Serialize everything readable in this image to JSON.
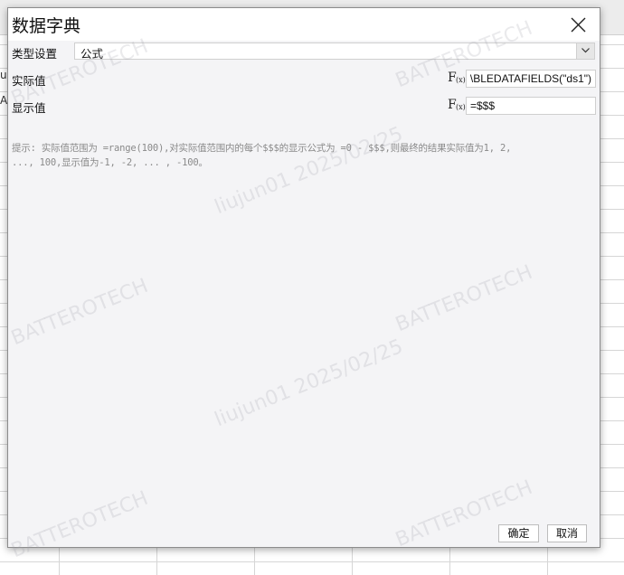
{
  "dialog": {
    "title": "数据字典",
    "type_label": "类型设置",
    "type_value": "公式",
    "actual_label": "实际值",
    "actual_formula": "\\BLEDATAFIELDS(\"ds1\")",
    "display_label": "显示值",
    "display_formula": "=$$$",
    "hint_line1": "提示: 实际值范围为 =range(100),对实际值范围内的每个$$$的显示公式为 =0 - $$$,则最终的结果实际值为1, 2,",
    "hint_line2": "..., 100,显示值为-1, -2, ... , -100。",
    "ok_label": "确定",
    "cancel_label": "取消"
  },
  "fx_icon": {
    "big": "F",
    "small": "(x)"
  },
  "watermark": {
    "company": "BATTEROTECH",
    "user_date": "liujun01 2025/02/25"
  },
  "sheet": {
    "frag_a": "un",
    "frag_b": "A"
  },
  "icons": {
    "close": "close-icon",
    "dropdown": "chevron-down-icon",
    "formula": "fx-icon"
  }
}
